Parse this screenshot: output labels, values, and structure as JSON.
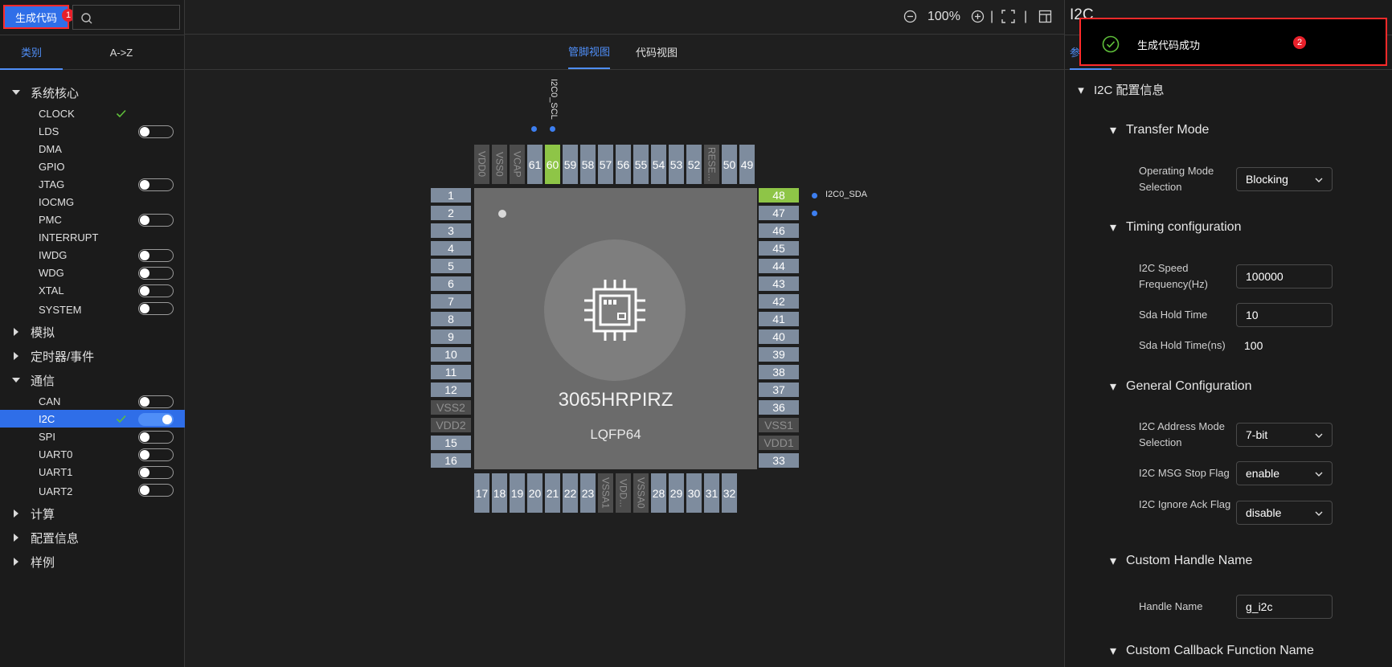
{
  "left": {
    "generate_button": "生成代码",
    "badge_1": "1",
    "tabs": [
      "类别",
      "A->Z"
    ],
    "tree": [
      {
        "type": "group",
        "label": "系统核心",
        "expanded": true
      },
      {
        "type": "item",
        "label": "CLOCK",
        "check": true,
        "toggle": null
      },
      {
        "type": "item",
        "label": "LDS",
        "check": false,
        "toggle": "off"
      },
      {
        "type": "item",
        "label": "DMA",
        "check": false,
        "toggle": null
      },
      {
        "type": "item",
        "label": "GPIO",
        "check": false,
        "toggle": null
      },
      {
        "type": "item",
        "label": "JTAG",
        "check": false,
        "toggle": "off"
      },
      {
        "type": "item",
        "label": "IOCMG",
        "check": false,
        "toggle": null
      },
      {
        "type": "item",
        "label": "PMC",
        "check": false,
        "toggle": "off"
      },
      {
        "type": "item",
        "label": "INTERRUPT",
        "check": false,
        "toggle": null
      },
      {
        "type": "item",
        "label": "IWDG",
        "check": false,
        "toggle": "off"
      },
      {
        "type": "item",
        "label": "WDG",
        "check": false,
        "toggle": "off"
      },
      {
        "type": "item",
        "label": "XTAL",
        "check": false,
        "toggle": "off"
      },
      {
        "type": "item",
        "label": "SYSTEM",
        "check": false,
        "toggle": "off"
      },
      {
        "type": "group",
        "label": "模拟",
        "expanded": false
      },
      {
        "type": "group",
        "label": "定时器/事件",
        "expanded": false
      },
      {
        "type": "group",
        "label": "通信",
        "expanded": true
      },
      {
        "type": "item",
        "label": "CAN",
        "check": false,
        "toggle": "off"
      },
      {
        "type": "item",
        "label": "I2C",
        "check": true,
        "toggle": "on",
        "selected": true
      },
      {
        "type": "item",
        "label": "SPI",
        "check": false,
        "toggle": "off"
      },
      {
        "type": "item",
        "label": "UART0",
        "check": false,
        "toggle": "off"
      },
      {
        "type": "item",
        "label": "UART1",
        "check": false,
        "toggle": "off"
      },
      {
        "type": "item",
        "label": "UART2",
        "check": false,
        "toggle": "off"
      },
      {
        "type": "group",
        "label": "计算",
        "expanded": false
      },
      {
        "type": "group",
        "label": "配置信息",
        "expanded": false
      },
      {
        "type": "group",
        "label": "样例",
        "expanded": false
      }
    ]
  },
  "topbar": {
    "zoom": "100%",
    "separators": [
      "|",
      "|"
    ]
  },
  "center": {
    "tabs": [
      "管脚视图",
      "代码视图"
    ],
    "chip": {
      "model": "3065HRPIRZ",
      "package": "LQFP64"
    },
    "signals": {
      "scl": "I2C0_SCL",
      "sda": "I2C0_SDA"
    },
    "pins": {
      "top": [
        {
          "label": "VDD0",
          "state": "disabled"
        },
        {
          "label": "VSS0",
          "state": "disabled"
        },
        {
          "label": "VCAP",
          "state": "disabled"
        },
        {
          "label": "61",
          "state": "normal"
        },
        {
          "label": "60",
          "state": "active"
        },
        {
          "label": "59",
          "state": "normal"
        },
        {
          "label": "58",
          "state": "normal"
        },
        {
          "label": "57",
          "state": "normal"
        },
        {
          "label": "56",
          "state": "normal"
        },
        {
          "label": "55",
          "state": "normal"
        },
        {
          "label": "54",
          "state": "normal"
        },
        {
          "label": "53",
          "state": "normal"
        },
        {
          "label": "52",
          "state": "normal"
        },
        {
          "label": "RESE...",
          "state": "disabled"
        },
        {
          "label": "50",
          "state": "normal"
        },
        {
          "label": "49",
          "state": "normal"
        }
      ],
      "left": [
        {
          "label": "1",
          "state": "normal"
        },
        {
          "label": "2",
          "state": "normal"
        },
        {
          "label": "3",
          "state": "normal"
        },
        {
          "label": "4",
          "state": "normal"
        },
        {
          "label": "5",
          "state": "normal"
        },
        {
          "label": "6",
          "state": "normal"
        },
        {
          "label": "7",
          "state": "normal"
        },
        {
          "label": "8",
          "state": "normal"
        },
        {
          "label": "9",
          "state": "normal"
        },
        {
          "label": "10",
          "state": "normal"
        },
        {
          "label": "11",
          "state": "normal"
        },
        {
          "label": "12",
          "state": "normal"
        },
        {
          "label": "VSS2",
          "state": "disabled"
        },
        {
          "label": "VDD2",
          "state": "disabled"
        },
        {
          "label": "15",
          "state": "normal"
        },
        {
          "label": "16",
          "state": "normal"
        }
      ],
      "right": [
        {
          "label": "48",
          "state": "active"
        },
        {
          "label": "47",
          "state": "normal"
        },
        {
          "label": "46",
          "state": "normal"
        },
        {
          "label": "45",
          "state": "normal"
        },
        {
          "label": "44",
          "state": "normal"
        },
        {
          "label": "43",
          "state": "normal"
        },
        {
          "label": "42",
          "state": "normal"
        },
        {
          "label": "41",
          "state": "normal"
        },
        {
          "label": "40",
          "state": "normal"
        },
        {
          "label": "39",
          "state": "normal"
        },
        {
          "label": "38",
          "state": "normal"
        },
        {
          "label": "37",
          "state": "normal"
        },
        {
          "label": "36",
          "state": "normal"
        },
        {
          "label": "VSS1",
          "state": "disabled"
        },
        {
          "label": "VDD1",
          "state": "disabled"
        },
        {
          "label": "33",
          "state": "normal"
        }
      ],
      "bottom": [
        {
          "label": "17",
          "state": "normal"
        },
        {
          "label": "18",
          "state": "normal"
        },
        {
          "label": "19",
          "state": "normal"
        },
        {
          "label": "20",
          "state": "normal"
        },
        {
          "label": "21",
          "state": "normal"
        },
        {
          "label": "22",
          "state": "normal"
        },
        {
          "label": "23",
          "state": "normal"
        },
        {
          "label": "VSSA1",
          "state": "disabled"
        },
        {
          "label": "VDD...",
          "state": "disabled"
        },
        {
          "label": "VSSA0",
          "state": "disabled"
        },
        {
          "label": "28",
          "state": "normal"
        },
        {
          "label": "29",
          "state": "normal"
        },
        {
          "label": "30",
          "state": "normal"
        },
        {
          "label": "31",
          "state": "normal"
        },
        {
          "label": "32",
          "state": "normal"
        }
      ]
    }
  },
  "right": {
    "title": "I2C",
    "tab": "参",
    "section_main": "I2C 配置信息",
    "transfer_mode": {
      "title": "Transfer Mode",
      "op_mode_label": "Operating Mode Selection",
      "op_mode_value": "Blocking"
    },
    "timing": {
      "title": "Timing configuration",
      "speed_label": "I2C Speed Frequency(Hz)",
      "speed_value": "100000",
      "sda_hold_label": "Sda Hold Time",
      "sda_hold_value": "10",
      "sda_hold_ns_label": "Sda Hold Time(ns)",
      "sda_hold_ns_value": "100"
    },
    "general": {
      "title": "General Configuration",
      "addr_mode_label": "I2C Address Mode Selection",
      "addr_mode_value": "7-bit",
      "stop_flag_label": "I2C MSG Stop Flag",
      "stop_flag_value": "enable",
      "ignore_ack_label": "I2C Ignore Ack Flag",
      "ignore_ack_value": "disable"
    },
    "handle": {
      "title": "Custom Handle Name",
      "label": "Handle Name",
      "value": "g_i2c"
    },
    "callback": {
      "title": "Custom Callback Function Name"
    }
  },
  "toast": {
    "message": "生成代码成功",
    "badge_2": "2"
  },
  "colors": {
    "accent": "#4f8ef7",
    "active_pin": "#8ec547",
    "pin": "#7e8c9e",
    "highlight_border": "#ff2a2a",
    "badge": "#e8202a"
  }
}
